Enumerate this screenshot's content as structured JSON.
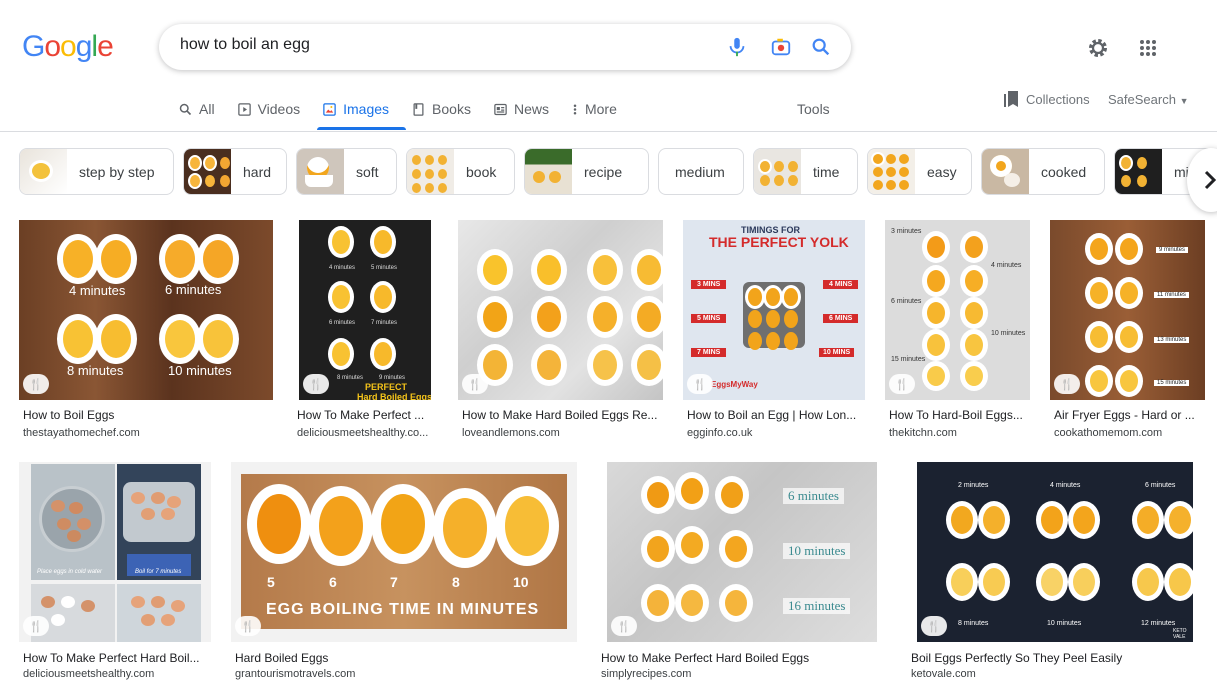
{
  "logo": {
    "letters": [
      "G",
      "o",
      "o",
      "g",
      "l",
      "e"
    ],
    "colors": [
      "#4285F4",
      "#EA4335",
      "#FBBC05",
      "#4285F4",
      "#34A853",
      "#EA4335"
    ]
  },
  "search": {
    "query": "how to boil an egg"
  },
  "icons": {
    "mic": "mic-icon",
    "lens": "lens-camera-icon",
    "search": "search-icon",
    "settings": "gear-icon",
    "apps": "apps-grid-icon"
  },
  "tabs": [
    {
      "label": "All",
      "icon": "search-icon"
    },
    {
      "label": "Videos",
      "icon": "play-icon"
    },
    {
      "label": "Images",
      "icon": "image-icon",
      "active": true
    },
    {
      "label": "Books",
      "icon": "book-icon"
    },
    {
      "label": "News",
      "icon": "news-icon"
    },
    {
      "label": "More",
      "icon": "more-vert-icon"
    }
  ],
  "tools": "Tools",
  "collections": "Collections",
  "safesearch": "SafeSearch",
  "accent": "#1a73e8",
  "chips": [
    "step by step",
    "hard",
    "soft",
    "book",
    "recipe",
    "medium",
    "time",
    "easy",
    "cooked",
    "mid"
  ],
  "results": [
    {
      "title": "How to Boil Eggs",
      "source": "thestayathomechef.com",
      "overlay": [
        "4 minutes",
        "6 minutes",
        "8 minutes",
        "10 minutes"
      ]
    },
    {
      "title": "How To Make Perfect ...",
      "source": "deliciousmeetshealthy.co...",
      "overlay": [
        "4 minutes",
        "5 minutes",
        "6 minutes",
        "7 minutes",
        "8 minutes",
        "9 minutes",
        "PERFECT",
        "Hard Boiled Eggs"
      ]
    },
    {
      "title": "How to Make Hard Boiled Eggs Re...",
      "source": "loveandlemons.com",
      "overlay": []
    },
    {
      "title": "How to Boil an Egg | How Lon...",
      "source": "egginfo.co.uk",
      "overlay": [
        "TIMINGS FOR",
        "THE PERFECT YOLK",
        "3 MINS",
        "5 MINS",
        "7 MINS",
        "4 MINS",
        "6 MINS",
        "10 MINS",
        "EggsMyWay"
      ]
    },
    {
      "title": "How To Hard-Boil Eggs...",
      "source": "thekitchn.com",
      "overlay": [
        "3 minutes",
        "4 minutes",
        "6 minutes",
        "10 minutes",
        "15 minutes"
      ]
    },
    {
      "title": "Air Fryer Eggs - Hard or ...",
      "source": "cookathomemom.com",
      "overlay": [
        "9 minutes",
        "11 minutes",
        "13 minutes",
        "15 minutes"
      ]
    },
    {
      "title": "How To Make Perfect Hard Boil...",
      "source": "deliciousmeetshealthy.com",
      "overlay": [
        "Place eggs in cold water",
        "Boil for 7 minutes"
      ]
    },
    {
      "title": "Hard Boiled Eggs",
      "source": "grantourismotravels.com",
      "overlay": [
        "5",
        "6",
        "7",
        "8",
        "10",
        "EGG BOILING TIME IN MINUTES"
      ]
    },
    {
      "title": "How to Make Perfect Hard Boiled Eggs",
      "source": "simplyrecipes.com",
      "overlay": [
        "6 minutes",
        "10 minutes",
        "16 minutes"
      ]
    },
    {
      "title": "Boil Eggs Perfectly So They Peel Easily",
      "source": "ketovale.com",
      "overlay": [
        "2 minutes",
        "4 minutes",
        "6 minutes",
        "8 minutes",
        "10 minutes",
        "12 minutes",
        "KETO VALE"
      ]
    }
  ]
}
